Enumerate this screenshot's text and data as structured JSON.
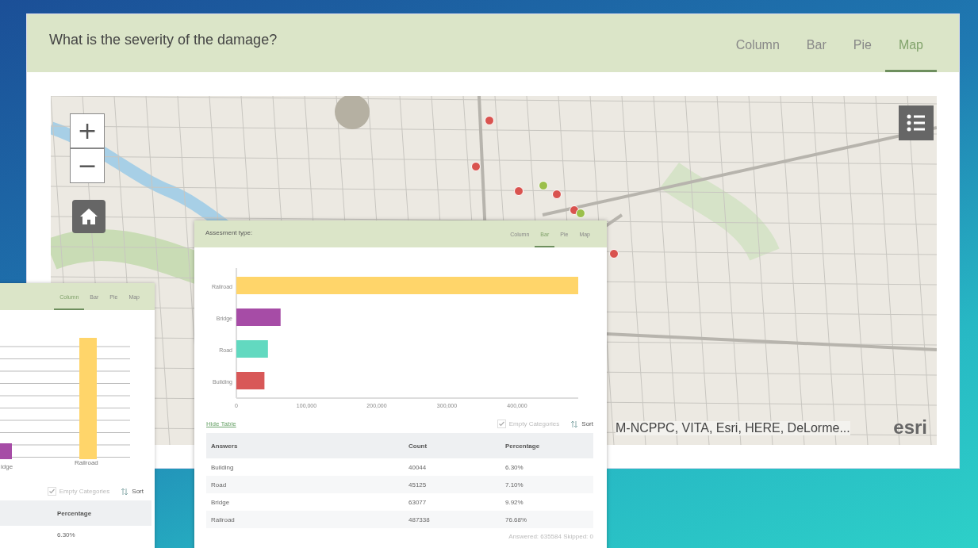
{
  "main_card": {
    "title": "What is the severity of the damage?",
    "tabs": [
      {
        "label": "Column",
        "selected": false
      },
      {
        "label": "Bar",
        "selected": false
      },
      {
        "label": "Pie",
        "selected": false
      },
      {
        "label": "Map",
        "selected": true
      }
    ],
    "map": {
      "markers": [
        {
          "color": "#d9534f"
        },
        {
          "color": "#d9534f"
        },
        {
          "color": "#d9534f"
        },
        {
          "color": "#9bbf4a"
        },
        {
          "color": "#d9534f"
        },
        {
          "color": "#d9534f"
        },
        {
          "color": "#9bbf4a"
        },
        {
          "color": "#d9534f"
        }
      ],
      "zoom_in": "+",
      "zoom_out": "−",
      "attribution": "M-NCPPC, VITA, Esri, HERE, DeLorme...",
      "logo": "esri"
    }
  },
  "back_card": {
    "tabs": [
      {
        "label": "Column",
        "selected": true
      },
      {
        "label": "Bar",
        "selected": false
      },
      {
        "label": "Pie",
        "selected": false
      },
      {
        "label": "Map",
        "selected": false
      }
    ],
    "bar_labels": [
      "idge",
      "Railroad"
    ],
    "empty_categories": {
      "label": "Empty Categories",
      "checked": true
    },
    "sort": "Sort",
    "table": {
      "columns": [
        "Percentage"
      ],
      "rows": [
        [
          "6.30%"
        ]
      ]
    }
  },
  "front_card": {
    "title": "Assesment type:",
    "tabs": [
      {
        "label": "Column",
        "selected": false
      },
      {
        "label": "Bar",
        "selected": true
      },
      {
        "label": "Pie",
        "selected": false
      },
      {
        "label": "Map",
        "selected": false
      }
    ],
    "chart_data": {
      "type": "bar",
      "orientation": "horizontal",
      "categories": [
        "Railroad",
        "Bridge",
        "Road",
        "Building"
      ],
      "series": [
        {
          "color": "#ffd56a",
          "values": [
            487000,
            null,
            null,
            null
          ]
        },
        {
          "color": "#a64ca6",
          "values": [
            null,
            63000,
            null,
            null
          ]
        },
        {
          "color": "#62d9c0",
          "values": [
            null,
            null,
            45000,
            null
          ]
        },
        {
          "color": "#d85858",
          "values": [
            null,
            null,
            null,
            40000
          ]
        }
      ],
      "xlim": [
        0,
        487000
      ],
      "xticks": [
        {
          "value": 0,
          "label": "0"
        },
        {
          "value": 100000,
          "label": "100,000"
        },
        {
          "value": 200000,
          "label": "200,000"
        },
        {
          "value": 300000,
          "label": "300,000"
        },
        {
          "value": 400000,
          "label": "400,000"
        }
      ]
    },
    "hide_table": "Hide Table",
    "empty_categories": {
      "label": "Empty Categories",
      "checked": true
    },
    "sort": "Sort",
    "table": {
      "columns": [
        "Answers",
        "Count",
        "Percentage"
      ],
      "rows": [
        [
          "Building",
          "40044",
          "6.30%"
        ],
        [
          "Road",
          "45125",
          "7.10%"
        ],
        [
          "Bridge",
          "63077",
          "9.92%"
        ],
        [
          "Railroad",
          "487338",
          "76.68%"
        ]
      ]
    },
    "footer": "Answered: 635584  Skipped: 0"
  }
}
